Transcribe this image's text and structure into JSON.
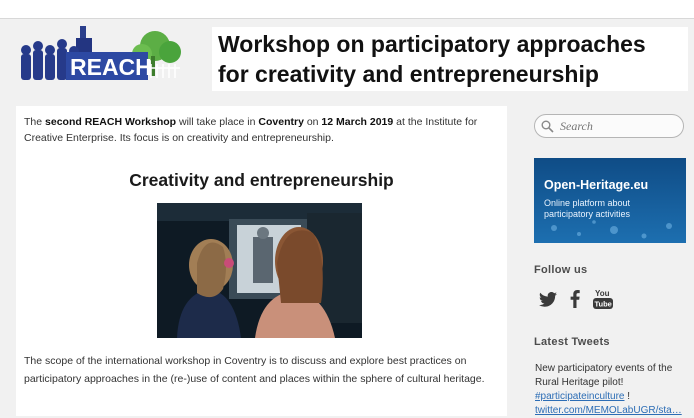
{
  "header": {
    "logo_text": "REACH",
    "title": "Workshop on participatory approaches for creativity and entrepreneurship"
  },
  "intro": {
    "p1": "The ",
    "b1": "second REACH Workshop",
    "p2": " will take place in ",
    "b2": "Coventry",
    "p3": " on ",
    "b3": "12 March 2019",
    "p4": " at the Institute for Creative Enterprise. Its focus is on creativity and entrepreneurship."
  },
  "section": {
    "title": "Creativity and entrepreneurship",
    "scope": "The scope of the international workshop in Coventry is to discuss and explore best practices on participatory approaches in the (re-)use of content and places within the sphere of cultural heritage."
  },
  "sidebar": {
    "search_placeholder": "Search",
    "banner_title": "Open-Heritage.eu",
    "banner_subtitle": "Online platform about participatory activities",
    "follow_heading": "Follow us",
    "youtube_label_1": "You",
    "youtube_label_2": "Tube",
    "tweets_heading": "Latest Tweets",
    "tweet_text": "New participatory events of the Rural Heritage pilot! ",
    "tweet_hashtag": "#participateinculture",
    "tweet_after_hashtag": " !",
    "tweet_link": "twitter.com/MEMOLabUGR/sta…"
  },
  "colors": {
    "accent_blue": "#2c6db5",
    "reach_green": "#4aa43c",
    "reach_navy": "#1f2a6e",
    "background": "#f1f1f1"
  },
  "icons": [
    "search-icon",
    "twitter-icon",
    "facebook-icon",
    "youtube-icon"
  ]
}
